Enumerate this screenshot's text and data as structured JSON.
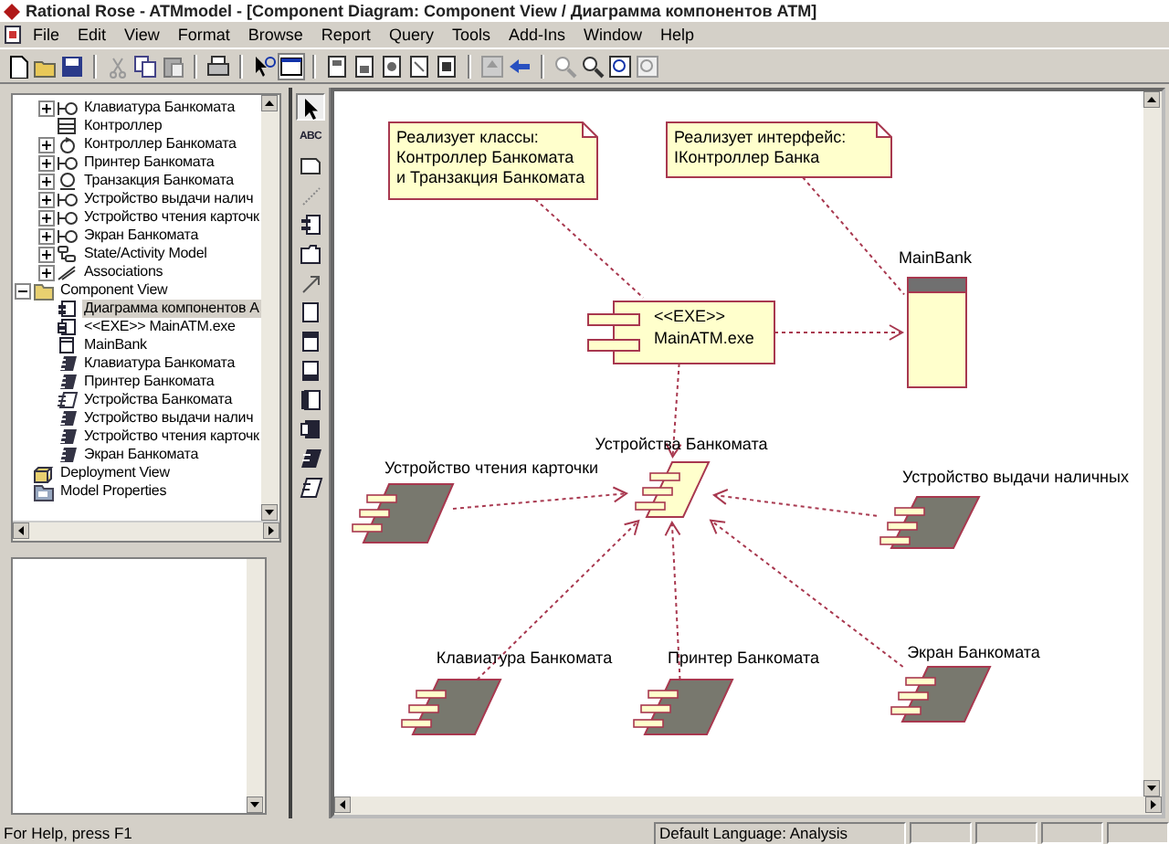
{
  "window": {
    "title": "Rational Rose - ATMmodel - [Component Diagram: Component View / Диаграмма компонентов ATM]"
  },
  "menu": [
    "File",
    "Edit",
    "View",
    "Format",
    "Browse",
    "Report",
    "Query",
    "Tools",
    "Add-Ins",
    "Window",
    "Help"
  ],
  "tree": {
    "scrolled_items": [
      {
        "label": "Клавиатура Банкомата",
        "kind": "interface",
        "expanded": false,
        "selected": false
      },
      {
        "label": "Контроллер",
        "kind": "class",
        "selected": false
      },
      {
        "label": "Контроллер Банкомата",
        "kind": "control",
        "expanded": false,
        "selected": false
      },
      {
        "label": "Принтер Банкомата",
        "kind": "interface",
        "expanded": false,
        "selected": false
      },
      {
        "label": "Транзакция Банкомата",
        "kind": "entity",
        "expanded": false,
        "selected": false
      },
      {
        "label": "Устройство выдачи налич",
        "kind": "interface",
        "expanded": false,
        "selected": false
      },
      {
        "label": "Устройство чтения карточк",
        "kind": "interface",
        "expanded": false,
        "selected": false
      },
      {
        "label": "Экран Банкомата",
        "kind": "interface",
        "expanded": false,
        "selected": false
      },
      {
        "label": "State/Activity Model",
        "kind": "state-model",
        "expanded": false,
        "selected": false
      },
      {
        "label": "Associations",
        "kind": "associations",
        "expanded": false,
        "selected": false
      }
    ],
    "items": [
      {
        "label": "Component View",
        "kind": "folder",
        "expanded": true,
        "selected": false,
        "children": [
          {
            "label": "Диаграмма компонентов A",
            "kind": "diagram",
            "selected": true
          },
          {
            "label": "<<EXE>> MainATM.exe",
            "kind": "exe",
            "selected": false
          },
          {
            "label": "MainBank",
            "kind": "main-program",
            "selected": false
          },
          {
            "label": "Клавиатура Банкомата",
            "kind": "task",
            "selected": false
          },
          {
            "label": "Принтер Банкомата",
            "kind": "task",
            "selected": false
          },
          {
            "label": "Устройства Банкомата",
            "kind": "package-spec",
            "selected": false
          },
          {
            "label": "Устройство выдачи налич",
            "kind": "task",
            "selected": false
          },
          {
            "label": "Устройство чтения карточк",
            "kind": "task",
            "selected": false
          },
          {
            "label": "Экран Банкомата",
            "kind": "task",
            "selected": false
          }
        ]
      },
      {
        "label": "Deployment View",
        "kind": "deployment",
        "selected": false
      },
      {
        "label": "Model Properties",
        "kind": "properties",
        "selected": false
      }
    ]
  },
  "toolbox": [
    {
      "kind": "pointer",
      "selected": true
    },
    {
      "kind": "text",
      "label": "ABC",
      "selected": false
    },
    {
      "kind": "note",
      "selected": false
    },
    {
      "kind": "note-link",
      "selected": false
    },
    {
      "kind": "component",
      "selected": false
    },
    {
      "kind": "package",
      "selected": false
    },
    {
      "kind": "dependency",
      "selected": false
    },
    {
      "kind": "main-program",
      "selected": false
    },
    {
      "kind": "subprogram-spec",
      "selected": false
    },
    {
      "kind": "subprogram-body",
      "selected": false
    },
    {
      "kind": "package-spec",
      "selected": false
    },
    {
      "kind": "package-body",
      "selected": false
    },
    {
      "kind": "task-spec",
      "selected": false
    },
    {
      "kind": "task-body",
      "selected": false
    }
  ],
  "diagram": {
    "nodes": [
      {
        "kind": "note",
        "lines": [
          "Реализует классы:",
          "Контроллер Банкомата",
          "и Транзакция Банкомата"
        ]
      },
      {
        "kind": "note",
        "lines": [
          "Реализует интерфейс:",
          "IКонтроллер Банка"
        ]
      },
      {
        "kind": "exe",
        "lines": [
          "<<EXE>>",
          "MainATM.exe"
        ]
      },
      {
        "kind": "main-program",
        "label": "MainBank"
      },
      {
        "kind": "package-spec",
        "label": "Устройства Банкомата"
      },
      {
        "kind": "task-body",
        "label": "Устройство чтения карточки"
      },
      {
        "kind": "task-body",
        "label": "Устройство выдачи наличных"
      },
      {
        "kind": "task-body",
        "label": "Клавиатура Банкомата"
      },
      {
        "kind": "task-body",
        "label": "Принтер Банкомата"
      },
      {
        "kind": "task-body",
        "label": "Экран Банкомата"
      }
    ]
  },
  "status_bar": {
    "help": "For Help, press F1",
    "language": "Default Language: Analysis"
  }
}
